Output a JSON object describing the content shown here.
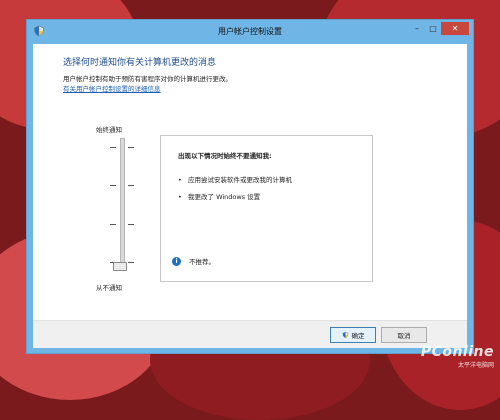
{
  "window": {
    "title": "用户帐户控制设置"
  },
  "caption_buttons": {
    "minimize": "–",
    "maximize": "□",
    "close": "✕"
  },
  "content": {
    "heading": "选择何时通知你有关计算机更改的消息",
    "description": "用户帐户控制有助于预防有害程序对你的计算机进行更改。",
    "link": "有关用户帐户控制设置的详细信息"
  },
  "slider": {
    "top_label": "始终通知",
    "bottom_label": "从不通知",
    "levels": 4,
    "current_level": 1
  },
  "info_panel": {
    "heading": "出现以下情况时始终不要通知我:",
    "items": [
      "应用尝试安装软件或更改我的计算机",
      "我更改了 Windows 设置"
    ],
    "note": "不推荐。"
  },
  "buttons": {
    "ok": "确定",
    "cancel": "取消"
  },
  "watermark": {
    "brand": "PConline",
    "sub": "太平洋电脑网"
  },
  "colors": {
    "title_bar": "#6fb6e6",
    "close_button": "#c9463d",
    "link": "#1a5fb4",
    "heading": "#1f4e8c"
  }
}
